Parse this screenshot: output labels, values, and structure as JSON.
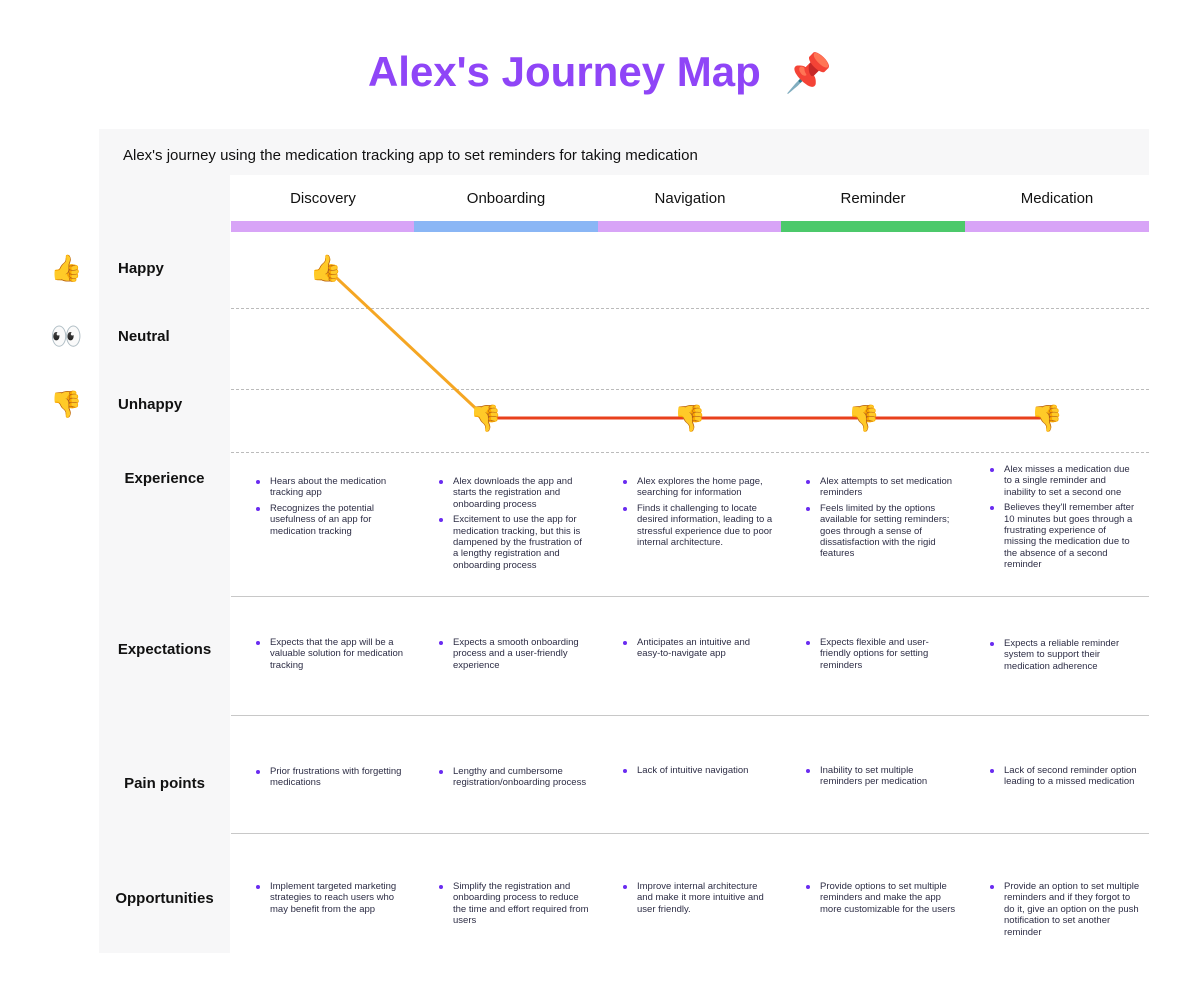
{
  "title": "Alex's Journey Map",
  "title_icon": "pushpin-icon",
  "subtitle": "Alex's journey using the medication tracking app to set reminders for taking medication",
  "colors": {
    "title": "#8f45f7",
    "bullet": "#6a2cf0",
    "line_up": "#f5a623",
    "line_down": "#e8401c"
  },
  "phases": [
    {
      "label": "Discovery",
      "color": "#d8a4f7"
    },
    {
      "label": "Onboarding",
      "color": "#8ab6f5"
    },
    {
      "label": "Navigation",
      "color": "#d8a4f7"
    },
    {
      "label": "Reminder",
      "color": "#4cc96b"
    },
    {
      "label": "Medication",
      "color": "#d8a4f7"
    }
  ],
  "emotions": [
    {
      "label": "Happy",
      "icon": "thumbs-up-icon"
    },
    {
      "label": "Neutral",
      "icon": "eyes-icon"
    },
    {
      "label": "Unhappy",
      "icon": "thumbs-down-icon"
    }
  ],
  "journey": [
    "Happy",
    "Unhappy",
    "Unhappy",
    "Unhappy",
    "Unhappy"
  ],
  "rows": [
    {
      "label": "Experience",
      "cells": [
        [
          "Hears about the medication tracking app",
          "Recognizes the potential usefulness of an app for medication tracking"
        ],
        [
          "Alex downloads the app and starts the registration and onboarding process",
          "Excitement to use the app for medication tracking, but this is dampened by the frustration of a lengthy registration and onboarding process"
        ],
        [
          "Alex explores the home page, searching for information",
          "Finds it challenging to locate desired information, leading to a stressful experience due to poor internal architecture."
        ],
        [
          "Alex attempts to set medication reminders",
          "Feels limited by the options available for setting reminders; goes through a sense of dissatisfaction with the rigid features"
        ],
        [
          "Alex misses a medication due to a single reminder and inability to set a second one",
          "Believes they'll remember after 10 minutes but goes through a frustrating experience of missing the medication due to the absence of a second reminder"
        ]
      ]
    },
    {
      "label": "Expectations",
      "cells": [
        [
          "Expects that the app will be a valuable solution for medication tracking"
        ],
        [
          "Expects a smooth onboarding process and a user-friendly experience"
        ],
        [
          "Anticipates an intuitive and easy-to-navigate app"
        ],
        [
          "Expects flexible and user-friendly options for setting reminders"
        ],
        [
          "Expects a reliable reminder system to support their medication adherence"
        ]
      ]
    },
    {
      "label": "Pain points",
      "cells": [
        [
          "Prior frustrations with forgetting medications"
        ],
        [
          "Lengthy and cumbersome registration/onboarding process"
        ],
        [
          "Lack of intuitive navigation"
        ],
        [
          "Inability to set multiple reminders per medication"
        ],
        [
          "Lack of second reminder option leading to a missed medication"
        ]
      ]
    },
    {
      "label": "Opportunities",
      "cells": [
        [
          "Implement targeted marketing strategies to reach users who may benefit from the app"
        ],
        [
          "Simplify the registration and onboarding  process to reduce the time and effort required from users"
        ],
        [
          "Improve internal architecture and make it more intuitive and user friendly."
        ],
        [
          "Provide options to set multiple reminders and make the app more customizable for the users"
        ],
        [
          "Provide an option to set multiple reminders and if they forgot to do it, give an option on the push notification to set another reminder"
        ]
      ]
    }
  ]
}
